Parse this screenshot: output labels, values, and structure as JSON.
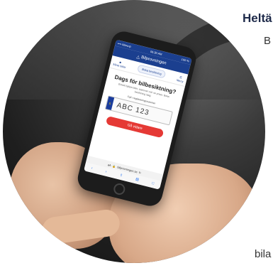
{
  "side_text": {
    "heading": "Heltä",
    "line1": "B",
    "line2": "bila"
  },
  "phone": {
    "status": {
      "carrier": "•••• Ma•u•p",
      "time": "06:30 AM",
      "battery": "100 %"
    },
    "brand": "Bilprovningen",
    "nav": {
      "left": "Mina sidor",
      "center": "Boka besiktning",
      "right": "Meny"
    },
    "heading": "Dags för bilbesiktning?",
    "sub": "Enkelt hjälpa tider, stationer och se priser. Boka besiktning idag.",
    "plate_label": "Fyll i registreringsnummer",
    "plate_value": "ABC 123",
    "plate_eu": "S",
    "button": "Gå vidare",
    "url_prefix": "aA",
    "url": "bilprovningen.se"
  },
  "colors": {
    "brand_blue": "#1b3f8f",
    "cta_red": "#e53935"
  },
  "icons": [
    "user-icon",
    "menu-icon",
    "lock-icon",
    "reload-icon",
    "back-icon",
    "forward-icon",
    "share-icon",
    "book-icon",
    "tabs-icon"
  ]
}
